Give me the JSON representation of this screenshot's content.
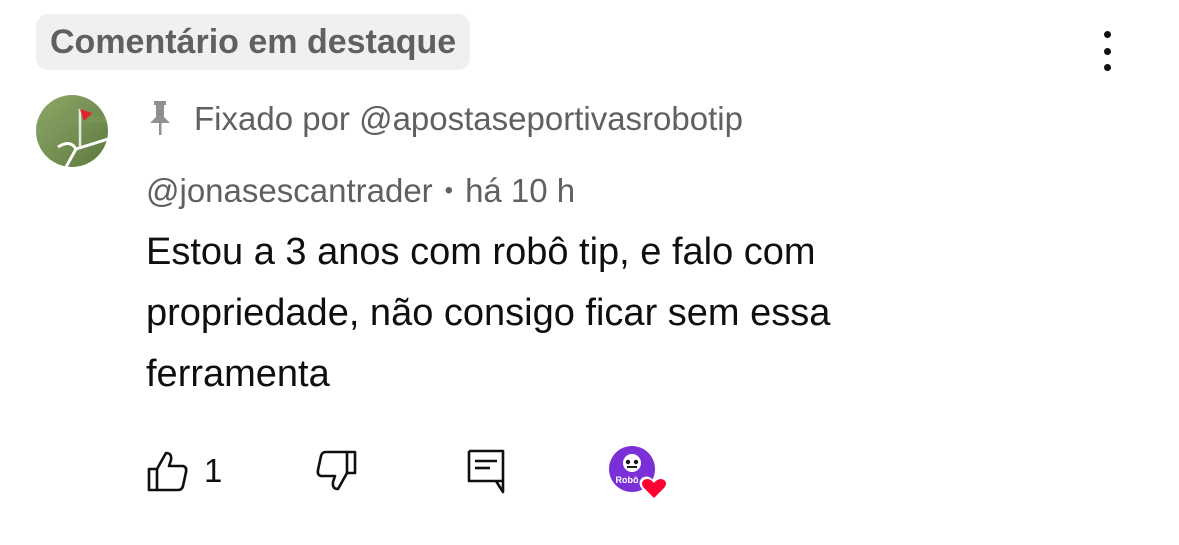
{
  "header": {
    "featured_label": "Comentário em destaque",
    "menu_icon": "more-vert-icon"
  },
  "comment": {
    "avatar_icon": "corner-flag-avatar",
    "pinned_icon": "pin-icon",
    "pinned_text": "Fixado por @apostaseportivasrobotip",
    "author": "@jonasescantrader",
    "separator": "•",
    "time": "há 10 h",
    "body": "Estou a 3 anos com robô tip, e falo com propriedade, não consigo ficar sem essa ferramenta"
  },
  "actions": {
    "like_icon": "thumbs-up-icon",
    "like_count": "1",
    "dislike_icon": "thumbs-down-icon",
    "reply_icon": "reply-comment-icon",
    "creator_heart": {
      "logo_text": "Robô",
      "heart_icon": "heart-icon",
      "heart_color": "#ff0033",
      "logo_color": "#7b2fd6"
    }
  }
}
